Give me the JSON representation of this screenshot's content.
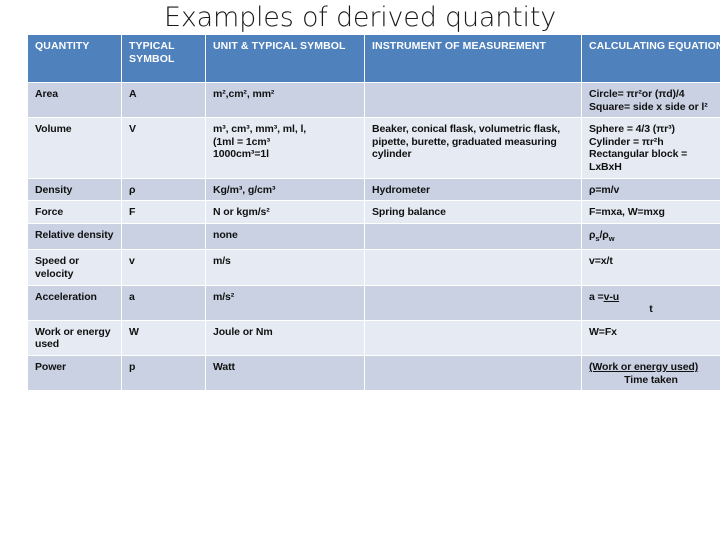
{
  "slide": {
    "title": "Examples of derived quantity"
  },
  "colors": {
    "header_bg": "#4F81BD",
    "header_text": "#FFFFFF",
    "row_dark": "#C9D1E3",
    "row_light": "#E5EAF3",
    "text": "#111111",
    "background": "#FFFFFF"
  },
  "table": {
    "headers": [
      "QUANTITY",
      "TYPICAL SYMBOL",
      "UNIT & TYPICAL SYMBOL",
      "INSTRUMENT OF MEASUREMENT",
      "CALCULATING EQUATION"
    ],
    "rows": [
      {
        "quantity": "Area",
        "symbol": "A",
        "unit": "m²,cm², mm²",
        "instrument": "",
        "equation_line1": "Circle= πr²or (πd)/4",
        "equation_line2": "Square= side x side or l²"
      },
      {
        "quantity": "Volume",
        "symbol": "V",
        "unit_line1": "m³, cm³, mm³, ml, l,",
        "unit_line2": "(1ml = 1cm³",
        "unit_line3": "1000cm³=1l",
        "instrument": "Beaker, conical flask, volumetric flask, pipette, burette, graduated measuring cylinder",
        "equation_line1": "Sphere = 4/3 (πr³)",
        "equation_line2": "Cylinder = πr²h",
        "equation_line3": "Rectangular block =",
        "equation_line4": "LxBxH"
      },
      {
        "quantity": "Density",
        "symbol": "ρ",
        "unit": "Kg/m³, g/cm³",
        "instrument": "Hydrometer",
        "equation": "ρ=m/v"
      },
      {
        "quantity": "Force",
        "symbol": "F",
        "unit": "N or kgm/s²",
        "instrument": "Spring balance",
        "equation": "F=mxa, W=mxg"
      },
      {
        "quantity": "Relative density",
        "symbol": "",
        "unit": "none",
        "instrument": "",
        "equation_main": "ρ",
        "equation_sub1": "s",
        "equation_mid": "/ρ",
        "equation_sub2": "w"
      },
      {
        "quantity": "Speed or velocity",
        "symbol": "v",
        "unit": "m/s",
        "instrument": "",
        "equation": "v=x/t"
      },
      {
        "quantity": "Acceleration",
        "symbol": "a",
        "unit": "m/s²",
        "instrument": "",
        "equation_prefix": "a =",
        "equation_numerator": "v-u",
        "equation_denominator": "t"
      },
      {
        "quantity": "Work or energy used",
        "symbol": "W",
        "unit": "Joule or Nm",
        "instrument": "",
        "equation": "W=Fx"
      },
      {
        "quantity": "Power",
        "symbol": "p",
        "unit": "Watt",
        "instrument": "",
        "equation_numerator": "(Work or energy used)",
        "equation_denominator": "Time taken"
      }
    ]
  }
}
